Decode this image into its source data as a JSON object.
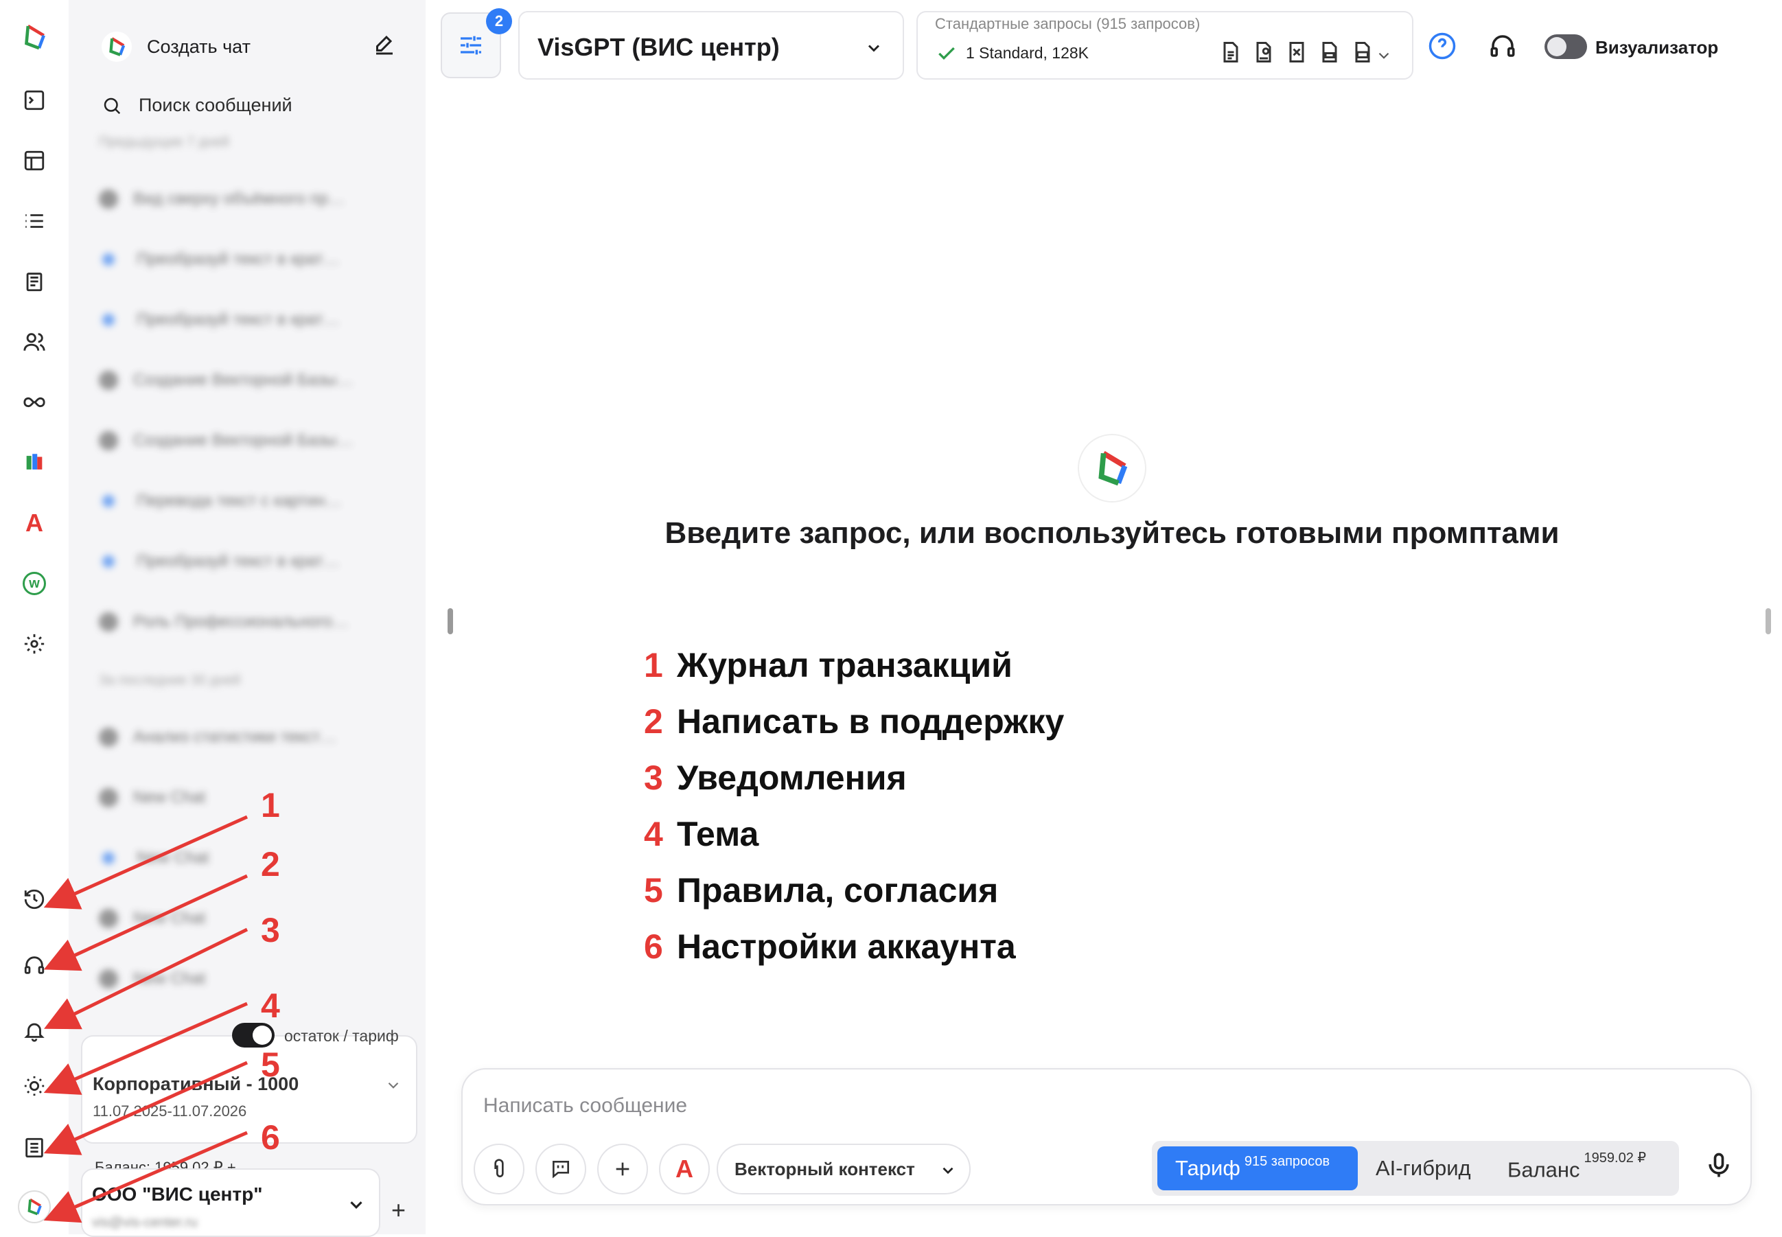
{
  "sidebar": {
    "new_chat": "Создать чат",
    "search": "Поиск сообщений",
    "group1": "Предыдущие 7 дней",
    "items1": [
      "Вид сверху объёмного пр…",
      "Преобразуй текст в крат…",
      "Преобразуй текст в крат…",
      "Создание Векторной Базы…",
      "Создание Векторной Базы…",
      "Перевода текст с картин…",
      "Преобразуй текст в крат…",
      "Роль Профессионального…"
    ],
    "group2": "За последние 30 дней",
    "items2": [
      "Анализ статистики текст…",
      "New Chat",
      "New Chat",
      "New Chat",
      "New Chat"
    ],
    "toggle_label": "остаток / тариф",
    "plan": "Корпоративный - 1000",
    "plan_dates": "11.07.2025-11.07.2026",
    "balance": "Баланс: 1959.02 ₽ +",
    "org": "ООО \"ВИС центр\"",
    "email": "vis@vis-center.ru"
  },
  "header": {
    "badge": "2",
    "model": "VisGPT (ВИС центр)",
    "req_title": "Стандартные запросы (915 запросов)",
    "req_value": "1 Standard, 128K",
    "visualizer": "Визуализатор"
  },
  "main": {
    "prompt": "Введите запрос, или воспользуйтесь готовыми промптами",
    "legend": [
      {
        "n": "1",
        "t": "Журнал транзакций"
      },
      {
        "n": "2",
        "t": "Написать в поддержку"
      },
      {
        "n": "3",
        "t": "Уведомления"
      },
      {
        "n": "4",
        "t": "Тема"
      },
      {
        "n": "5",
        "t": "Правила, согласия"
      },
      {
        "n": "6",
        "t": "Настройки аккаунта"
      }
    ]
  },
  "composer": {
    "placeholder": "Написать сообщение",
    "vector": "Векторный контекст",
    "tariff": "Тариф",
    "tariff_sup": "915 запросов",
    "hybrid": "AI-гибрид",
    "balance": "Баланс",
    "balance_sup": "1959.02 ₽"
  },
  "colors": {
    "accent": "#2f7cf6",
    "annotation": "#e53935"
  }
}
